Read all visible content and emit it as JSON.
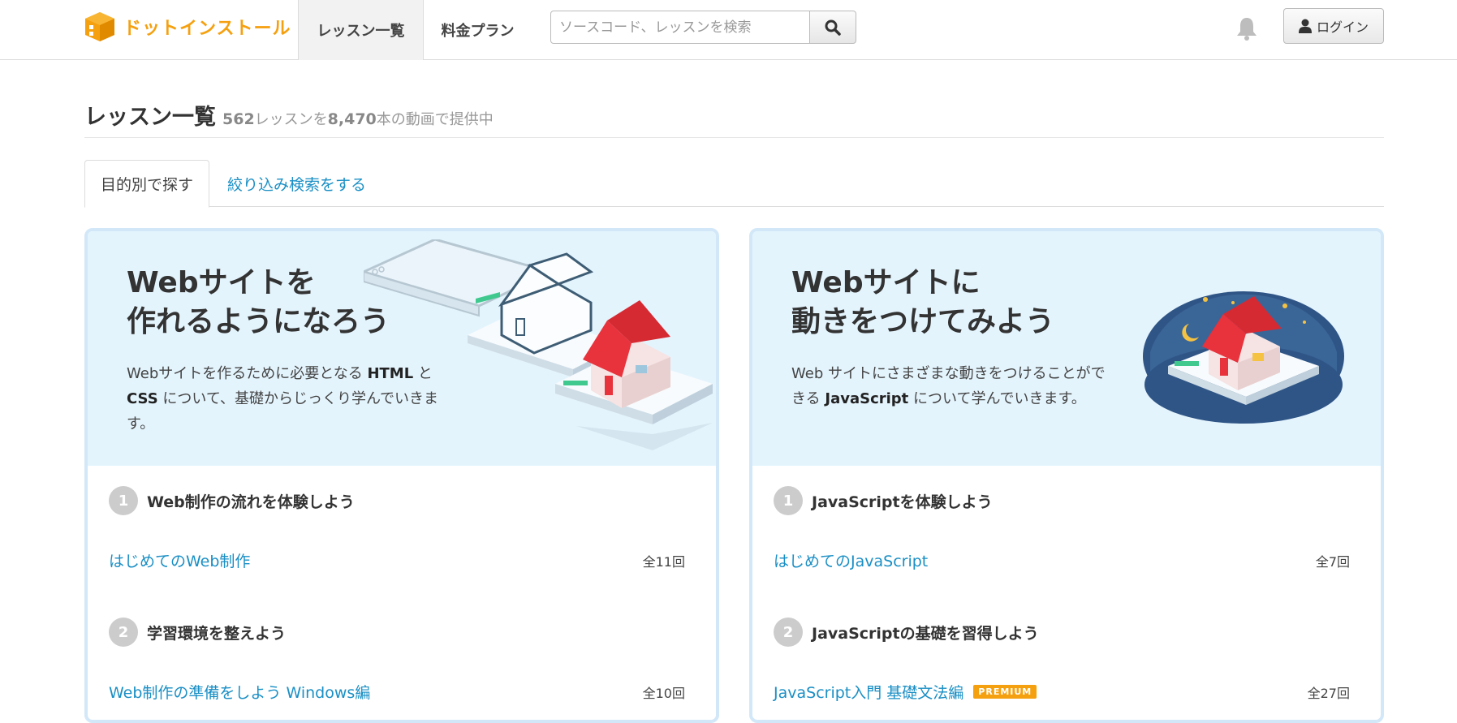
{
  "header": {
    "logo_text": "ドットインストール",
    "nav": [
      {
        "label": "レッスン一覧"
      },
      {
        "label": "料金プラン"
      }
    ],
    "search": {
      "placeholder": "ソースコード、レッスンを検索",
      "value": ""
    },
    "login_label": "ログイン"
  },
  "page": {
    "title": "レッスン一覧",
    "lesson_count": "562",
    "lesson_suffix": "レッスンを",
    "video_count": "8,470",
    "video_suffix": "本の動画で提供中"
  },
  "tabs": [
    {
      "label": "目的別で探す",
      "active": true
    },
    {
      "label": "絞り込み検索をする",
      "active": false
    }
  ],
  "cards": [
    {
      "title": "Webサイトを\n作れるようになろう",
      "desc_parts": [
        "Webサイトを作るために必要となる ",
        "HTML",
        " と ",
        "CSS",
        " について、基礎からじっくり学んでいきます。"
      ],
      "steps": [
        {
          "num": "1",
          "title": "Web制作の流れを体験しよう",
          "lesson": {
            "label": "はじめてのWeb制作",
            "count": "全11回"
          }
        },
        {
          "num": "2",
          "title": "学習環境を整えよう",
          "lesson": {
            "label": "Web制作の準備をしよう Windows編",
            "count": "全10回",
            "premium": false
          }
        }
      ]
    },
    {
      "title": "Webサイトに\n動きをつけてみよう",
      "desc_parts": [
        "Web サイトにさまざまな動きをつけることができる ",
        "JavaScript",
        " について学んでいきます。"
      ],
      "steps": [
        {
          "num": "1",
          "title": "JavaScriptを体験しよう",
          "lesson": {
            "label": "はじめてのJavaScript",
            "count": "全7回"
          }
        },
        {
          "num": "2",
          "title": "JavaScriptの基礎を習得しよう",
          "lesson": {
            "label": "JavaScript入門 基礎文法編",
            "count": "全27回",
            "premium_label": "PREMIUM"
          }
        }
      ]
    }
  ],
  "colors": {
    "brand": "#f5a00f",
    "link": "#1a8fc5",
    "hero_bg": "#e4f4fd",
    "card_border": "#d2e8f8",
    "house_roof": "#e8323c"
  }
}
